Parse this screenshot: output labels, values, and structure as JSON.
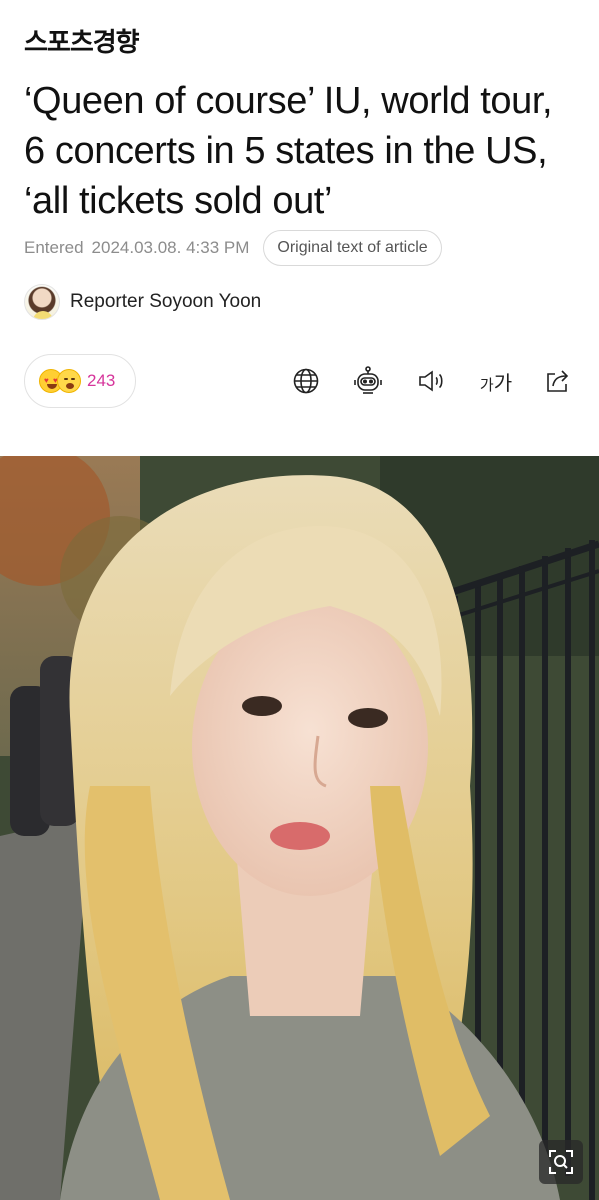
{
  "masthead": {
    "logo_text": "스포츠경향"
  },
  "article": {
    "headline": "‘Queen of course’ IU, world tour, 6 concerts in 5 states in the US, ‘all tickets sold out’",
    "entered_label": "Entered",
    "entered_datetime": "2024.03.08. 4:33 PM",
    "original_text_button": "Original text of article",
    "reporter": "Reporter Soyoon Yoon"
  },
  "reactions": {
    "count": "243",
    "emojis": [
      "heart-eyes-emoji",
      "grinning-emoji"
    ]
  },
  "toolbar": {
    "icons": [
      "globe-icon",
      "robot-icon",
      "speaker-icon",
      "font-size-icon",
      "share-icon"
    ],
    "font_size_small": "가",
    "font_size_big": "가"
  },
  "photo": {
    "zoom_icon": "zoom-icon"
  },
  "colors": {
    "reaction_count": "#d6359b",
    "meta_gray": "#8c8c8c"
  }
}
